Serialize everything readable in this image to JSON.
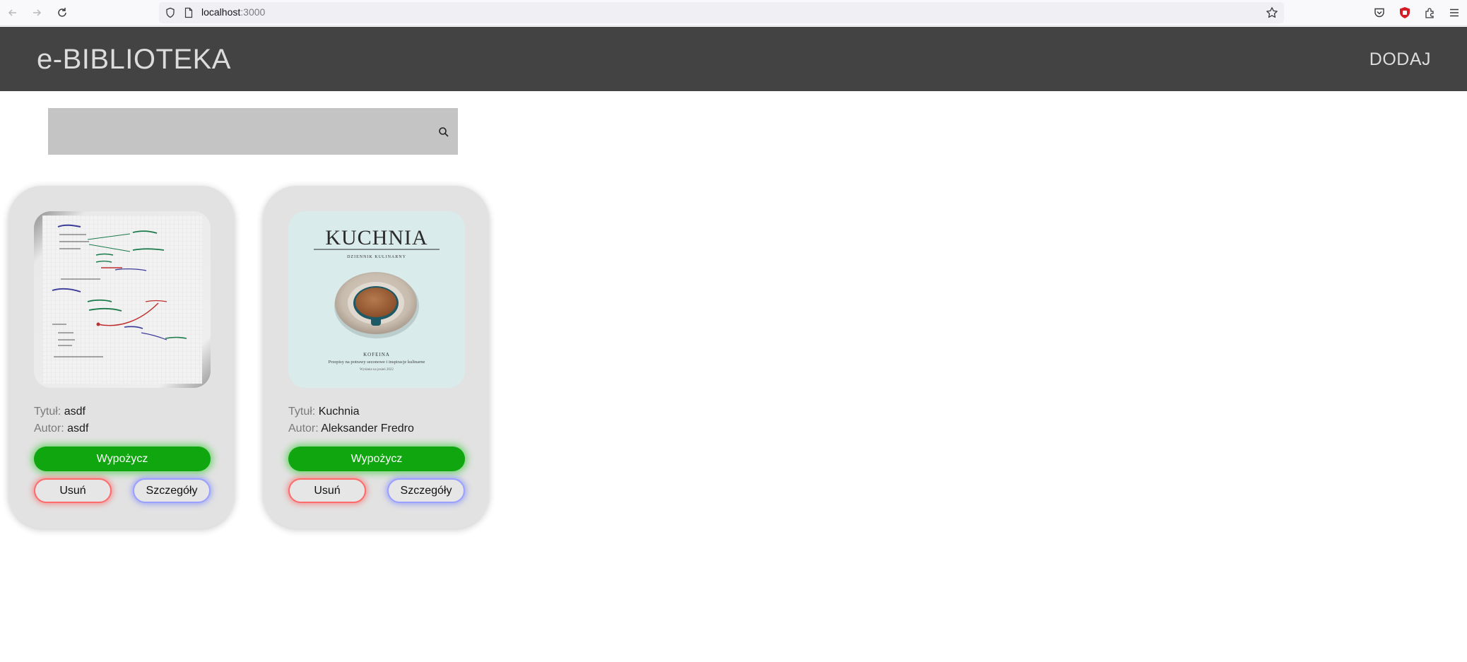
{
  "browser": {
    "url_host": "localhost",
    "url_port": ":3000"
  },
  "header": {
    "brand": "e-BIBLIOTEKA",
    "add_label": "DODAJ"
  },
  "search": {
    "value": "",
    "placeholder": ""
  },
  "labels": {
    "title": "Tytuł:",
    "author": "Autor:"
  },
  "books": [
    {
      "title": "asdf",
      "author": "asdf",
      "borrow_label": "Wypożycz",
      "remove_label": "Usuń",
      "details_label": "Szczegóły"
    },
    {
      "title": "Kuchnia",
      "author": "Aleksander Fredro",
      "borrow_label": "Wypożycz",
      "remove_label": "Usuń",
      "details_label": "Szczegóły",
      "cover": {
        "heading": "KUCHNIA",
        "subheading": "DZIENNIK KULINARNY",
        "caption": "KOFEINA",
        "line1": "Przepisy na potrawy sezonowe i inspiracje kulinarne",
        "line2": "Wydanie na jesień 2022"
      }
    }
  ],
  "colors": {
    "header_bg": "#434343",
    "card_bg": "#e2e2e2",
    "borrow_green": "#10a610",
    "remove_red": "#ff6a6a",
    "details_blue": "#9aa0ff"
  }
}
